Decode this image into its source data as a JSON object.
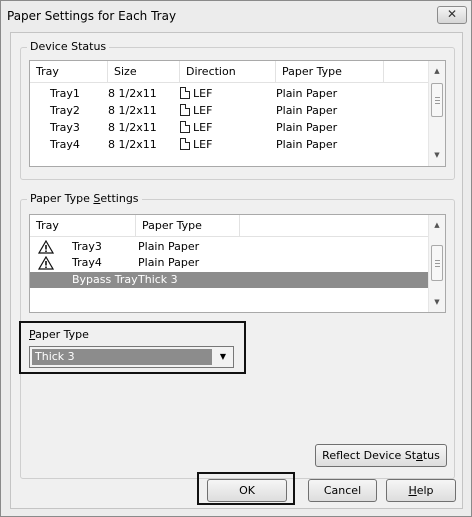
{
  "window": {
    "title": "Paper Settings for Each Tray",
    "close_glyph": "✕"
  },
  "device_status": {
    "group_label": "Device Status",
    "columns": [
      "Tray",
      "Size",
      "Direction",
      "Paper Type"
    ],
    "rows": [
      {
        "tray": "Tray1",
        "size": "8 1/2x11",
        "direction": "LEF",
        "paper_type": "Plain Paper"
      },
      {
        "tray": "Tray2",
        "size": "8 1/2x11",
        "direction": "LEF",
        "paper_type": "Plain Paper"
      },
      {
        "tray": "Tray3",
        "size": "8 1/2x11",
        "direction": "LEF",
        "paper_type": "Plain Paper"
      },
      {
        "tray": "Tray4",
        "size": "8 1/2x11",
        "direction": "LEF",
        "paper_type": "Plain Paper"
      }
    ]
  },
  "paper_type_settings": {
    "group_label_pre": "Paper Type ",
    "group_label_u": "S",
    "group_label_post": "ettings",
    "columns": [
      "Tray",
      "Paper Type"
    ],
    "rows": [
      {
        "tray": "Tray3",
        "paper_type": "Plain Paper",
        "icon": "warning-icon",
        "selected": false
      },
      {
        "tray": "Tray4",
        "paper_type": "Plain Paper",
        "icon": "warning-icon",
        "selected": false
      },
      {
        "tray": "Bypass Tray",
        "paper_type": "Thick 3",
        "icon": "",
        "selected": true
      }
    ]
  },
  "paper_type_select": {
    "label_u": "P",
    "label_rest": "aper Type",
    "value": "Thick 3"
  },
  "buttons": {
    "reflect_pre": "Reflect Device St",
    "reflect_u": "a",
    "reflect_post": "tus",
    "ok": "OK",
    "cancel": "Cancel",
    "help_u": "H",
    "help_rest": "elp"
  },
  "colors": {
    "selection": "#8c8c8c",
    "dialog_bg": "#f0f0f0"
  }
}
